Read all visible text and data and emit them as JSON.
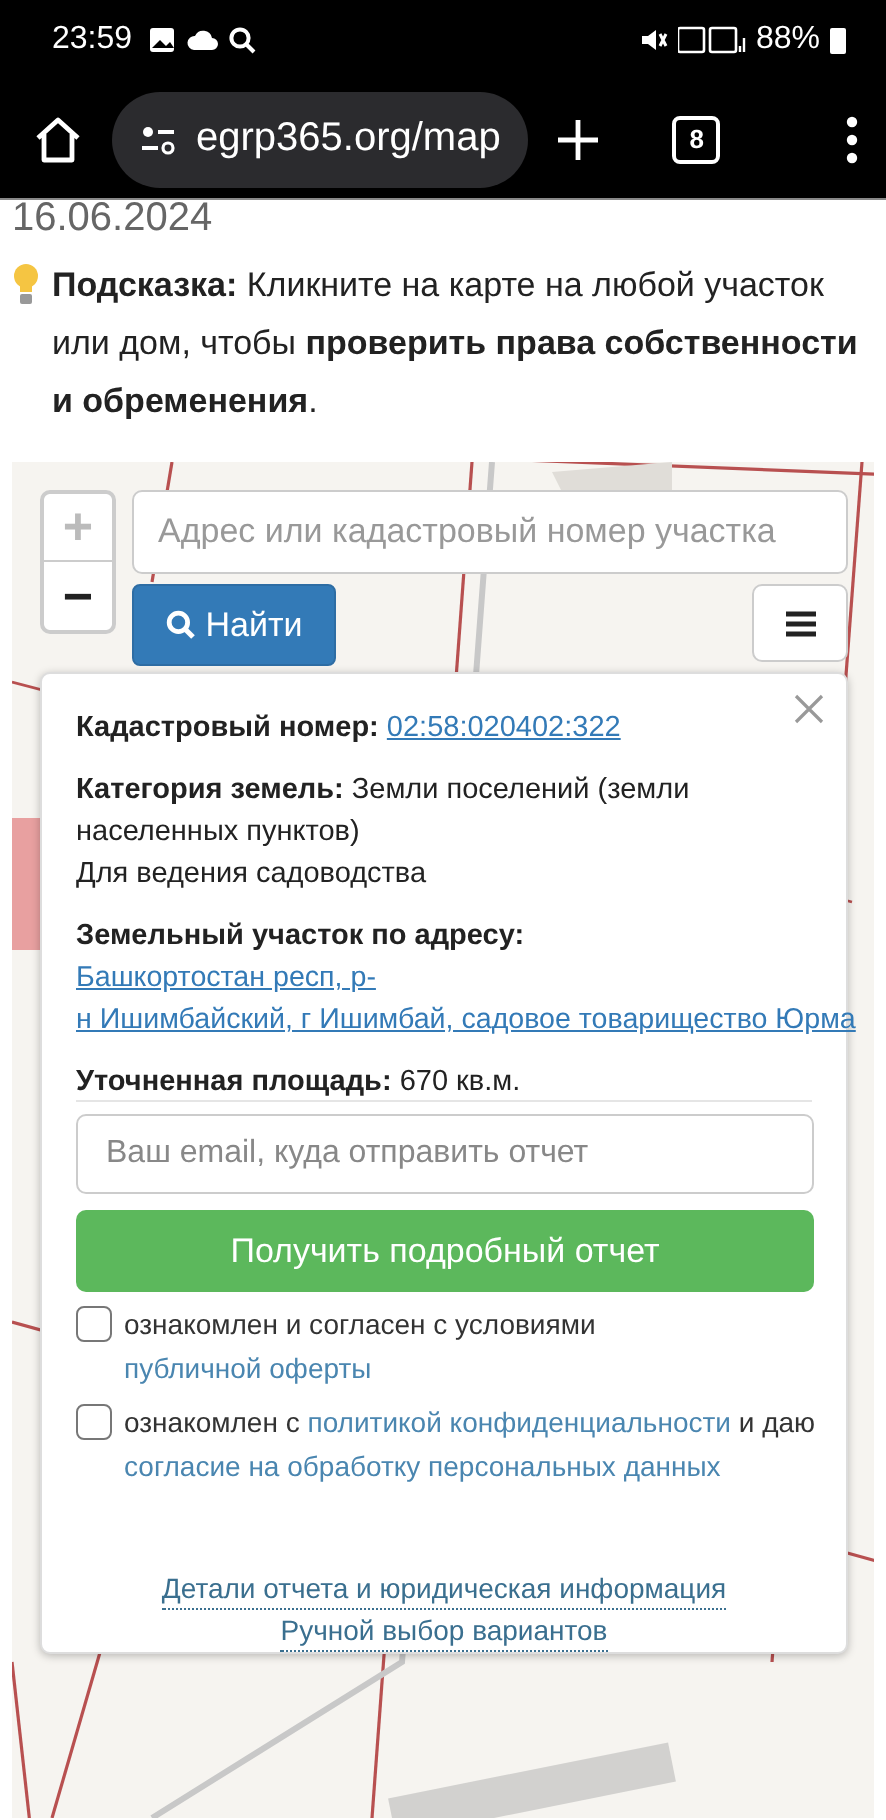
{
  "status_bar": {
    "time": "23:59",
    "battery": "88%"
  },
  "browser": {
    "url": "egrp365.org/map",
    "tab_count": "8"
  },
  "page": {
    "date": "16.06.2024",
    "hint": "**Подсказка:** Кликните на карте на любой участок или дом, чтобы **проверить права собственности и обременения**."
  },
  "map": {
    "zoom_in": "+",
    "zoom_out": "−",
    "search": {
      "placeholder": "Адрес или кадастровый номер участка"
    },
    "find_button": "Найти",
    "popup": {
      "rows": [
        {
          "kind": "link",
          "label": "Кадастровый номер:",
          "value": "02:58:020402:322"
        },
        {
          "kind": "inline",
          "label": "Категория земель:",
          "value": "Земли поселений (земли населенных пунктов)"
        },
        {
          "kind": "plain",
          "value": "Для ведения садоводства"
        },
        {
          "kind": "block",
          "label": "Земельный участок по адресу:",
          "lines": [
            "Башкортостан респ, р-",
            "н Ишимбайский, г Ишимбай, садовое товарищество Юрма"
          ]
        },
        {
          "kind": "inline",
          "label": "Уточненная площадь:",
          "value": "670 кв.м."
        }
      ],
      "email": {
        "placeholder": "Ваш email, куда отправить отчет"
      },
      "report_button": "Получить подробный отчет",
      "consents": [
        {
          "checked": false,
          "parts": [
            {
              "kind": "text",
              "text": "ознакомлен и согласен с условиями"
            },
            {
              "kind": "link",
              "text": "публичной оферты"
            }
          ]
        },
        {
          "checked": false,
          "parts": [
            {
              "kind": "text",
              "text": "ознакомлен с"
            },
            {
              "kind": "link",
              "text": "политикой конфиденциальности"
            },
            {
              "kind": "text",
              "text": "и даю"
            },
            {
              "kind": "link",
              "text": "согласие на обработку персональных данных"
            }
          ]
        }
      ],
      "footer_links": [
        "Детали отчета и юридическая информация",
        "Ручной выбор вариантов"
      ]
    }
  }
}
